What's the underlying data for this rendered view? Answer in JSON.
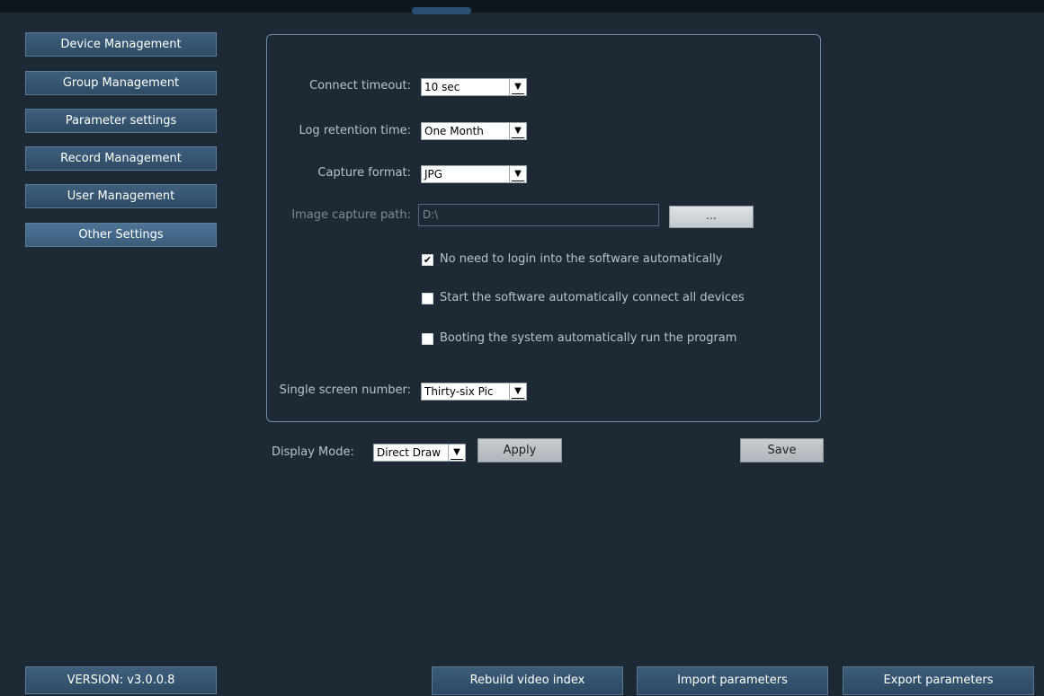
{
  "sidebar": {
    "items": [
      {
        "label": "Device Management"
      },
      {
        "label": "Group Management"
      },
      {
        "label": "Parameter settings"
      },
      {
        "label": "Record Management"
      },
      {
        "label": "User Management"
      },
      {
        "label": "Other Settings",
        "active": true
      }
    ],
    "version": "VERSION: v3.0.0.8"
  },
  "settings": {
    "connect_timeout": {
      "label": "Connect timeout:",
      "value": "10 sec"
    },
    "log_retention": {
      "label": "Log retention time:",
      "value": "One Month"
    },
    "capture_format": {
      "label": "Capture format:",
      "value": "JPG"
    },
    "image_capture_path": {
      "label": "Image capture path:",
      "value": "D:\\",
      "browse_label": "..."
    },
    "checkboxes": [
      {
        "label": "No need to login into the software automatically",
        "checked": true
      },
      {
        "label": "Start the software automatically connect all devices",
        "checked": false
      },
      {
        "label": "Booting the system automatically run the program",
        "checked": false
      }
    ],
    "single_screen_number": {
      "label": "Single screen number:",
      "value": "Thirty-six Pic"
    }
  },
  "display": {
    "label": "Display Mode:",
    "value": "Direct Draw",
    "apply_label": "Apply",
    "save_label": "Save"
  },
  "footer": {
    "rebuild_label": "Rebuild video index",
    "import_label": "Import parameters",
    "export_label": "Export parameters"
  },
  "icons": {
    "dropdown": "dropdown-arrow-icon",
    "checkbox_checked": "check-icon"
  },
  "colors": {
    "background": "#1d2a36",
    "nav_button": "#3f5f7c",
    "panel_border": "#6b8aa6"
  }
}
